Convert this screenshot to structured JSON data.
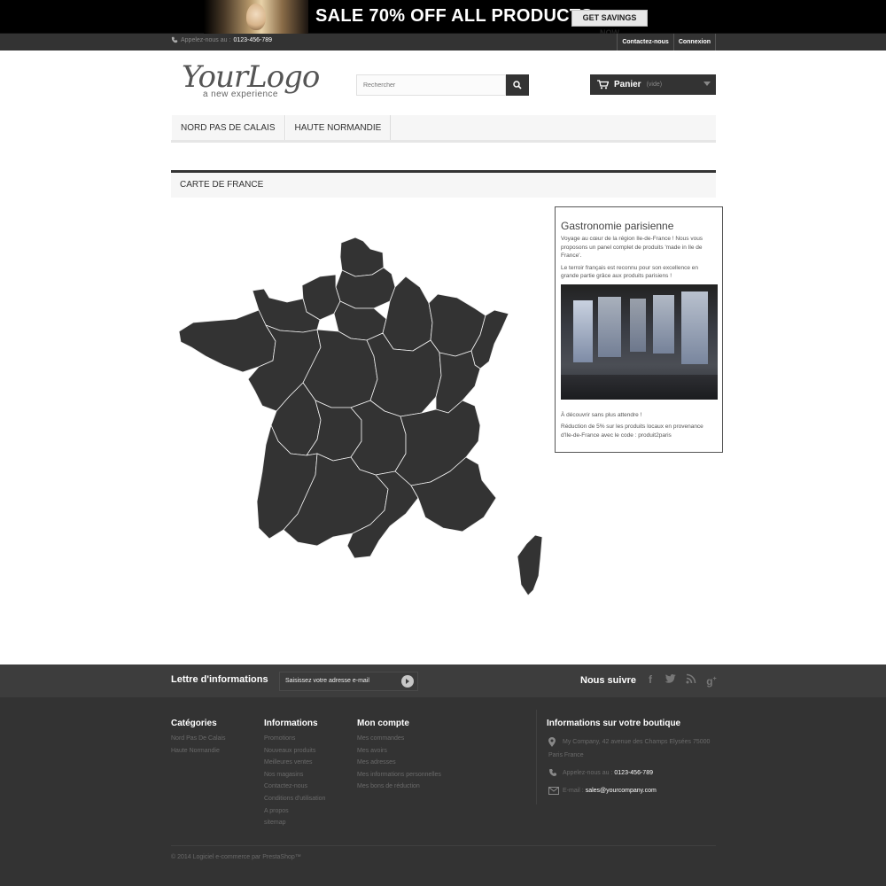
{
  "banner": {
    "headline": "SALE 70% OFF ALL PRODUCTS",
    "cta": "GET SAVINGS NOW"
  },
  "nav": {
    "phone_prefix": "Appelez-nous au :",
    "phone": "0123-456-789",
    "contact": "Contactez-nous",
    "login": "Connexion"
  },
  "header": {
    "logo_text": "YourLogo",
    "logo_tagline": "a new experience",
    "search_placeholder": "Rechercher",
    "cart_label": "Panier",
    "cart_status": "(vide)"
  },
  "menu": {
    "items": [
      "NORD PAS DE CALAIS",
      "HAUTE NORMANDIE"
    ]
  },
  "page": {
    "block_title": "CARTE DE FRANCE"
  },
  "colors": {
    "map_fill": "#333333",
    "map_border": "#f2f2f2",
    "accent_dark": "#333333"
  },
  "side_block": {
    "title": "Gastronomie parisienne",
    "p1": "Voyage au cœur de la région Ile-de-France ! Nous vous proposons un panel complet de produits 'made in Ile de France'.",
    "p2": "Le terroir français est reconnu pour son excellence en grande partie grâce aux produits parisiens !",
    "p3": "À découvrir sans plus attendre !",
    "p4": "Réduction de 5% sur les produits locaux en provenance d'Ile-de-France avec le code : produit2paris"
  },
  "newsletter": {
    "title": "Lettre d'informations",
    "input_value": "Saisissez votre adresse e-mail",
    "follow": "Nous suivre"
  },
  "footer": {
    "categories": {
      "title": "Catégories",
      "items": [
        "Nord Pas De Calais",
        "Haute Normandie"
      ]
    },
    "informations": {
      "title": "Informations",
      "items": [
        "Promotions",
        "Nouveaux produits",
        "Meilleures ventes",
        "Nos magasins",
        "Contactez-nous",
        "Conditions d'utilisation",
        "A propos",
        "sitemap"
      ]
    },
    "account": {
      "title": "Mon compte",
      "items": [
        "Mes commandes",
        "Mes avoirs",
        "Mes adresses",
        "Mes informations personnelles",
        "Mes bons de réduction"
      ]
    },
    "store": {
      "title": "Informations sur votre boutique",
      "address_line1": "My Company, 42 avenue des Champs Elysées 75000",
      "address_line2": "Paris France",
      "phone_label": "Appelez-nous au :",
      "phone": "0123-456-789",
      "email_label": "E-mail :",
      "email": "sales@yourcompany.com"
    },
    "copyright": "© 2014 Logiciel e-commerce par PrestaShop™"
  }
}
